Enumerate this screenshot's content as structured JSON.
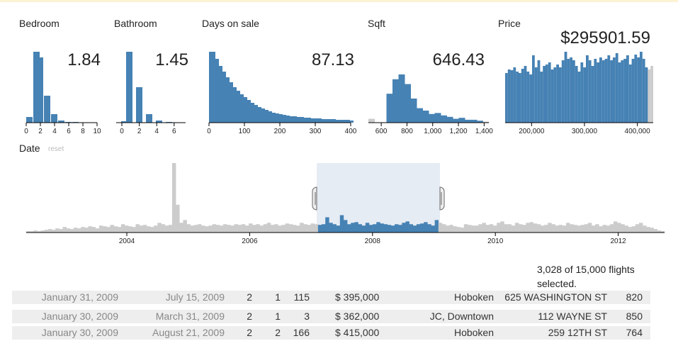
{
  "colors": {
    "selected": "#4682b4",
    "unselected": "#cccccc",
    "brush": "#e6ecf4"
  },
  "reset_label": "reset",
  "charts": [
    {
      "id": "bedroom",
      "label": "Bedroom",
      "mean": "1.84",
      "ticks": [
        "0",
        "2",
        "4",
        "6",
        "8",
        "10"
      ]
    },
    {
      "id": "bathroom",
      "label": "Bathroom",
      "mean": "1.45",
      "ticks": [
        "0",
        "2",
        "4",
        "6"
      ]
    },
    {
      "id": "days",
      "label": "Days on sale",
      "mean": "87.13",
      "ticks": [
        "0",
        "100",
        "200",
        "300",
        "400"
      ]
    },
    {
      "id": "sqft",
      "label": "Sqft",
      "mean": "646.43",
      "ticks": [
        "600",
        "800",
        "1,000",
        "1,200",
        "1,400"
      ]
    },
    {
      "id": "price",
      "label": "Price",
      "mean": "$295901.59",
      "ticks": [
        "200,000",
        "300,000",
        "400,000"
      ]
    },
    {
      "id": "date",
      "label": "Date",
      "ticks": [
        "2004",
        "2006",
        "2008",
        "2010",
        "2012"
      ]
    }
  ],
  "chart_data": [
    {
      "type": "bar",
      "name": "Bedroom",
      "x_range": [
        0,
        10
      ],
      "bin_width": 0.5,
      "x": [
        0,
        1,
        1.5,
        2.5,
        3.5,
        4.5,
        5.5,
        6.5
      ],
      "values": [
        8,
        100,
        92,
        38,
        12,
        3,
        1,
        1
      ]
    },
    {
      "type": "bar",
      "name": "Bathroom",
      "x_range": [
        0,
        7
      ],
      "bin_width": 0.5,
      "x": [
        0.5,
        1,
        2,
        3,
        4,
        5
      ],
      "values": [
        2,
        100,
        50,
        12,
        3,
        1
      ]
    },
    {
      "type": "bar",
      "name": "Days on sale",
      "x_range": [
        0,
        400
      ],
      "bin_width": 10,
      "x": [
        0,
        10,
        20,
        30,
        40,
        50,
        60,
        70,
        80,
        90,
        100,
        110,
        120,
        130,
        140,
        150,
        160,
        170,
        180,
        190,
        200,
        210,
        220,
        230,
        240,
        250,
        260,
        270,
        280,
        290,
        300,
        310,
        320,
        330,
        340,
        350,
        360,
        370,
        380,
        390
      ],
      "values": [
        100,
        90,
        80,
        72,
        64,
        57,
        50,
        45,
        40,
        36,
        32,
        28,
        25,
        22,
        20,
        18,
        16,
        14,
        13,
        12,
        11,
        10,
        9,
        9,
        8,
        8,
        7,
        7,
        6,
        6,
        6,
        5,
        5,
        5,
        5,
        4,
        4,
        4,
        4,
        3
      ]
    },
    {
      "type": "bar",
      "name": "Sqft",
      "x_range": [
        500,
        1500
      ],
      "bin_width": 50,
      "x": [
        500,
        550,
        600,
        650,
        700,
        750,
        800,
        850,
        900,
        950,
        1000,
        1050,
        1100,
        1150,
        1200,
        1250,
        1300,
        1350,
        1400,
        1450,
        1500
      ],
      "values": [
        8,
        0,
        0,
        60,
        90,
        100,
        80,
        50,
        30,
        25,
        18,
        20,
        15,
        12,
        8,
        10,
        6,
        6,
        4,
        2,
        0
      ],
      "selected_range": [
        550,
        1450
      ]
    },
    {
      "type": "bar",
      "name": "Price",
      "x_range": [
        150000,
        430000
      ],
      "bin_width": 5000,
      "values": [
        70,
        75,
        74,
        78,
        72,
        70,
        76,
        80,
        72,
        68,
        95,
        78,
        88,
        72,
        80,
        82,
        85,
        75,
        78,
        82,
        78,
        88,
        100,
        90,
        92,
        88,
        80,
        72,
        85,
        78,
        95,
        88,
        80,
        90,
        85,
        92,
        88,
        90,
        95,
        88,
        92,
        98,
        85,
        88,
        90,
        95,
        82,
        90,
        96,
        92,
        100,
        90,
        78,
        75,
        80
      ],
      "selected_range": [
        150000,
        425000
      ]
    },
    {
      "type": "bar",
      "name": "Date",
      "x_range": [
        "2002-06",
        "2012-12"
      ],
      "values": [
        2,
        2,
        3,
        2,
        3,
        4,
        5,
        4,
        6,
        5,
        8,
        6,
        5,
        7,
        6,
        8,
        7,
        9,
        8,
        6,
        10,
        9,
        8,
        11,
        9,
        8,
        12,
        10,
        9,
        8,
        12,
        10,
        11,
        9,
        8,
        10,
        14,
        12,
        10,
        11,
        100,
        40,
        14,
        18,
        12,
        10,
        11,
        12,
        10,
        9,
        10,
        12,
        11,
        10,
        12,
        11,
        10,
        12,
        11,
        12,
        10,
        13,
        11,
        12,
        10,
        12,
        14,
        11,
        12,
        10,
        11,
        13,
        12,
        11,
        10,
        14,
        12,
        11,
        13,
        12,
        11,
        12,
        22,
        14,
        12,
        10,
        25,
        18,
        12,
        14,
        15,
        12,
        10,
        14,
        11,
        12,
        15,
        13,
        12,
        11,
        10,
        12,
        11,
        14,
        16,
        12,
        10,
        12,
        13,
        15,
        12,
        10,
        18,
        14,
        12,
        10,
        11,
        9,
        8,
        7,
        12,
        11,
        10,
        10,
        12,
        14,
        11,
        12,
        10,
        14,
        16,
        12,
        12,
        10,
        14,
        12,
        11,
        14,
        15,
        13,
        12,
        10,
        11,
        14,
        12,
        10,
        11,
        10,
        14,
        12,
        11,
        10,
        11,
        12,
        14,
        10,
        12,
        9,
        11,
        10,
        12,
        16,
        14,
        12,
        10,
        8,
        9,
        12,
        14,
        10,
        8,
        7,
        5,
        3,
        2
      ],
      "selected_range": [
        "2007-02",
        "2009-02"
      ]
    }
  ],
  "count": {
    "selected": "3,028",
    "total": "15,000",
    "line1_suffix": "flights",
    "line2": "selected."
  },
  "rows": [
    {
      "date": "January 31, 2009",
      "listed": "July 15, 2009",
      "bed": "2",
      "bath": "1",
      "days": "115",
      "price": "$ 395,000",
      "city": "Hoboken",
      "address": "625 WASHINGTON ST",
      "sqft": "820"
    },
    {
      "date": "January 30, 2009",
      "listed": "March 31, 2009",
      "bed": "2",
      "bath": "1",
      "days": "3",
      "price": "$ 362,000",
      "city": "JC, Downtown",
      "address": "112 WAYNE ST",
      "sqft": "850"
    },
    {
      "date": "January 30, 2009",
      "listed": "August 21, 2009",
      "bed": "2",
      "bath": "2",
      "days": "166",
      "price": "$ 415,000",
      "city": "Hoboken",
      "address": "259 12TH ST",
      "sqft": "764"
    }
  ]
}
